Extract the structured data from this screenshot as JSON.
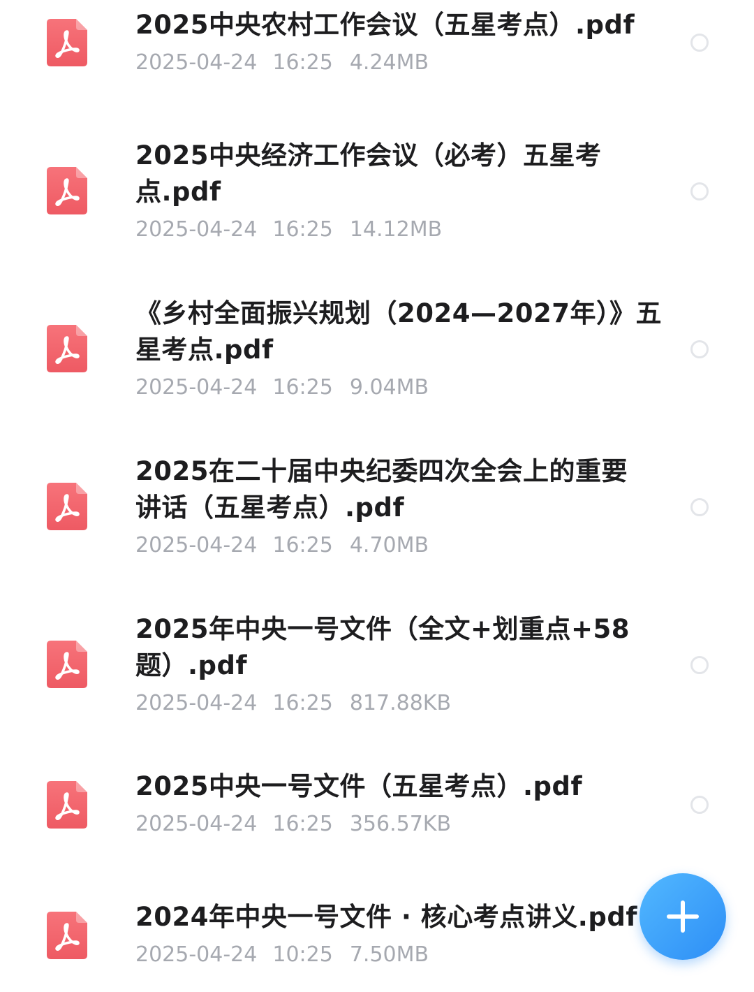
{
  "files": [
    {
      "name_lines": [
        "2025中央农村工作会议（五星考点）.pdf"
      ],
      "date": "2025-04-24",
      "time": "16:25",
      "size": "4.24MB",
      "icon": "pdf-file-icon",
      "selected": false
    },
    {
      "name_lines": [
        "2025中央经济工作会议（必考）五星考",
        "点.pdf"
      ],
      "date": "2025-04-24",
      "time": "16:25",
      "size": "14.12MB",
      "icon": "pdf-file-icon",
      "selected": false
    },
    {
      "name_lines": [
        "《乡村全面振兴规划（2024—2027年）》五",
        "星考点.pdf"
      ],
      "date": "2025-04-24",
      "time": "16:25",
      "size": "9.04MB",
      "icon": "pdf-file-icon",
      "selected": false
    },
    {
      "name_lines": [
        "2025在二十届中央纪委四次全会上的重要",
        "讲话（五星考点）.pdf"
      ],
      "date": "2025-04-24",
      "time": "16:25",
      "size": "4.70MB",
      "icon": "pdf-file-icon",
      "selected": false
    },
    {
      "name_lines": [
        "2025年中央一号文件（全文+划重点+58",
        "题）.pdf"
      ],
      "date": "2025-04-24",
      "time": "16:25",
      "size": "817.88KB",
      "icon": "pdf-file-icon",
      "selected": false
    },
    {
      "name_lines": [
        "2025中央一号文件（五星考点）.pdf"
      ],
      "date": "2025-04-24",
      "time": "16:25",
      "size": "356.57KB",
      "icon": "pdf-file-icon",
      "selected": false
    },
    {
      "name_lines": [
        "2024年中央一号文件 · 核心考点讲义.pdf"
      ],
      "date": "2025-04-24",
      "time": "10:25",
      "size": "7.50MB",
      "icon": "pdf-file-icon",
      "selected": false
    }
  ],
  "fab": {
    "icon": "plus-icon"
  },
  "colors": {
    "pdf_icon_top": "#f7737a",
    "pdf_icon_bottom": "#ee5a63",
    "title_text": "#1d1d1f",
    "meta_text": "#a6a9b0",
    "radio_border": "#e3e5e9",
    "fab_start": "#52b8ff",
    "fab_end": "#2d8ef6"
  }
}
